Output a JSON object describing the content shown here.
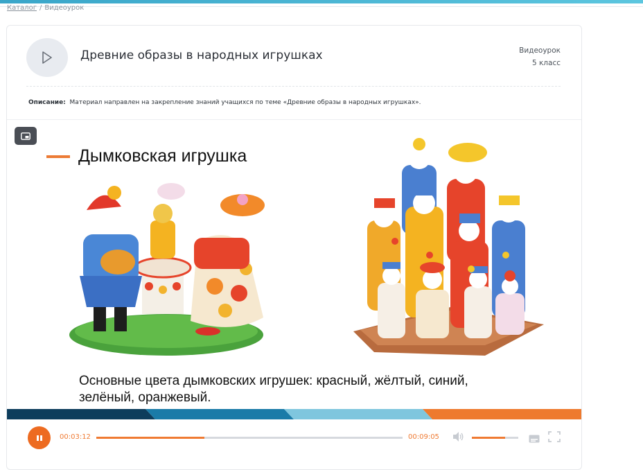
{
  "breadcrumb": {
    "catalog": "Каталог",
    "separator": "/",
    "current": "Видеоурок"
  },
  "lesson": {
    "title": "Древние образы в народных игрушках",
    "type": "Видеоурок",
    "grade": "5 класс",
    "description_label": "Описание:",
    "description": "Материал направлен на закрепление знаний учащихся по теме «Древние образы в народных игрушках»."
  },
  "slide": {
    "heading": "Дымковская игрушка",
    "text": "Основные цвета дымковских игрушек: красный, жёлтый, синий, зелёный, оранжевый."
  },
  "player": {
    "current_time": "00:03:12",
    "duration": "00:09:05",
    "progress": 0.352,
    "volume": 0.72
  },
  "colors": {
    "accent": "#ed6b21",
    "stripe": [
      "#0d3d5c",
      "#1a7ba8",
      "#7fc6de",
      "#ee7a2e"
    ]
  },
  "icons": [
    "play-icon",
    "picture-in-picture-icon",
    "pause-icon",
    "volume-icon",
    "captions-icon",
    "fullscreen-icon"
  ]
}
